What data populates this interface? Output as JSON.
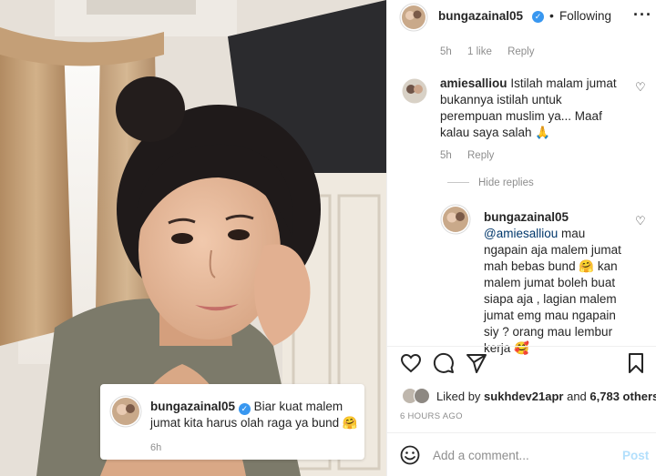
{
  "post": {
    "username": "bungazainal05",
    "follow_status": "Following",
    "caption_text": "Biar kuat malem jumat kita harus olah raga ya bund 🤗",
    "caption_time": "6h"
  },
  "comments": [
    {
      "meta": {
        "time": "5h",
        "likes": "1 like",
        "reply": "Reply"
      }
    },
    {
      "username": "amiesalliou",
      "text": "Istilah malam jumat bukannya istilah untuk perempuan muslim ya... Maaf kalau saya salah 🙏",
      "time": "5h",
      "reply": "Reply"
    }
  ],
  "hide_replies": "Hide replies",
  "reply": {
    "username": "bungazainal05",
    "mention": "@amiesalliou",
    "text": " mau ngapain aja malem jumat mah bebas bund 🤗 kan malem jumat boleh buat siapa aja , lagian malem jumat emg mau ngapain siy ? orang mau lembur kerja 🥰"
  },
  "likes": {
    "prefix": "Liked by ",
    "user": "sukhdev21apr",
    "middle": " and ",
    "count": "6,783 others"
  },
  "time_ago": "6 HOURS AGO",
  "add_comment": {
    "placeholder": "Add a comment...",
    "post_label": "Post"
  },
  "colors": {
    "link_blue": "#3897f0",
    "post_disabled": "#b2dffc",
    "muted": "#8e8e8e"
  },
  "icons": [
    "more-icon",
    "heart-icon",
    "comment-icon",
    "share-icon",
    "bookmark-icon",
    "emoji-icon",
    "verified-icon"
  ]
}
